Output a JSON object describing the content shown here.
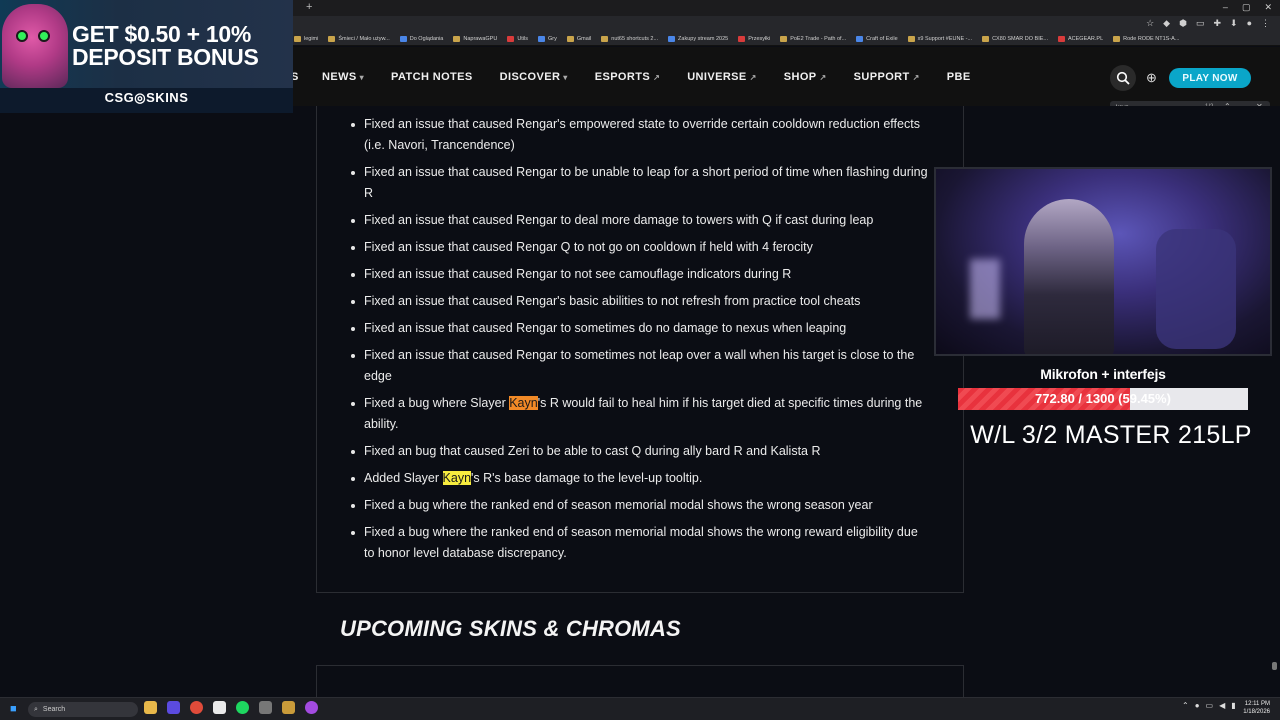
{
  "browser": {
    "new_tab_label": "+",
    "window_controls": [
      "–",
      "▢",
      "✕"
    ],
    "bookmarks": [
      "legimi",
      "Śmieci / Mało używ...",
      "Do Oglądania",
      "NaprawaGPU",
      "Utils",
      "Gry",
      "Gmail",
      "nut65 shortcuts 2...",
      "Zakupy stream 2025",
      "Przesyłki",
      "PoE2 Trade - Path of...",
      "Craft of Exile",
      "x9 Support #EUNE -...",
      "CX80 SMAR DO BIE...",
      "ACEGEAR.PL",
      "Rode RODE NT1S-A..."
    ],
    "find": {
      "query": "kayn",
      "count": "1/2"
    }
  },
  "nav": {
    "cut_label": "S",
    "items": [
      {
        "label": "NEWS",
        "marker": "▾"
      },
      {
        "label": "PATCH NOTES",
        "marker": ""
      },
      {
        "label": "DISCOVER",
        "marker": "▾"
      },
      {
        "label": "ESPORTS",
        "marker": "↗"
      },
      {
        "label": "UNIVERSE",
        "marker": "↗"
      },
      {
        "label": "SHOP",
        "marker": "↗"
      },
      {
        "label": "SUPPORT",
        "marker": "↗"
      },
      {
        "label": "PBE",
        "marker": ""
      }
    ],
    "play_button": "PLAY NOW"
  },
  "ad": {
    "line1": "GET $0.50 + 10%",
    "line2": "DEPOSIT BONUS",
    "brand": "CSG◎SKINS"
  },
  "notes": [
    {
      "text": "Fixed an issue that caused Rengar's empowered state to override certain cooldown reduction effects (i.e. Navori, Trancendence)"
    },
    {
      "text": "Fixed an issue that caused Rengar to be unable to leap for a short period of time when flashing during R"
    },
    {
      "text": "Fixed an issue that caused Rengar to deal more damage to towers with Q if cast during leap"
    },
    {
      "text": "Fixed an issue that caused Rengar Q to not go on cooldown if held with 4 ferocity"
    },
    {
      "text": "Fixed an issue that caused Rengar to not see camouflage indicators during R"
    },
    {
      "text": "Fixed an issue that caused Rengar's basic abilities to not refresh from practice tool cheats"
    },
    {
      "text": "Fixed an issue that caused Rengar to sometimes do no damage to nexus when leaping"
    },
    {
      "text": "Fixed an issue that caused Rengar to sometimes not leap over a wall when his target is close to the edge"
    },
    {
      "before": "Fixed a bug where Slayer ",
      "highlight": "Kayn",
      "after": "'s R would fail to heal him if his target died at specific times during the ability.",
      "hl": "orange"
    },
    {
      "text": "Fixed an bug that caused Zeri to be able to cast Q during ally bard R and Kalista R"
    },
    {
      "before": "Added Slayer ",
      "highlight": "Kayn",
      "after": "'s R's base damage to the level-up tooltip.",
      "hl": "yellow"
    },
    {
      "text": "Fixed a bug where the ranked end of season memorial modal shows the wrong season year"
    },
    {
      "text": "Fixed a bug where the ranked end of season memorial modal shows the wrong reward eligibility due to honor level database discrepancy."
    }
  ],
  "section_title": "UPCOMING SKINS & CHROMAS",
  "overlay": {
    "mic_label": "Mikrofon + interfejs",
    "progress_text": "772.80 / 1300 (59.45%)",
    "progress_fraction": 0.5945,
    "wl_text": "W/L 3/2 MASTER 215LP"
  },
  "taskbar": {
    "search_placeholder": "Search",
    "clock_time": "12:11 PM",
    "clock_date": "1/18/2026"
  },
  "colors": {
    "accent": "#0aa6c9",
    "highlight_current": "#f28a27",
    "highlight_match": "#f7ec3f",
    "progress_fill": "#e8323d"
  }
}
